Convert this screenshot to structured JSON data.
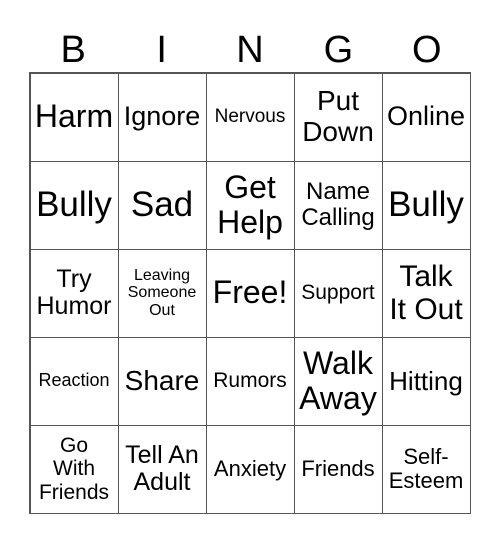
{
  "header": [
    "B",
    "I",
    "N",
    "G",
    "O"
  ],
  "cells": [
    "Harm",
    "Ignore",
    "Nervous",
    "Put\nDown",
    "Online",
    "Bully",
    "Sad",
    "Get\nHelp",
    "Name\nCalling",
    "Bully",
    "Try\nHumor",
    "Leaving\nSomeone\nOut",
    "Free!",
    "Support",
    "Talk\nIt Out",
    "Reaction",
    "Share",
    "Rumors",
    "Walk\nAway",
    "Hitting",
    "Go\nWith\nFriends",
    "Tell An\nAdult",
    "Anxiety",
    "Friends",
    "Self-\nEsteem"
  ]
}
